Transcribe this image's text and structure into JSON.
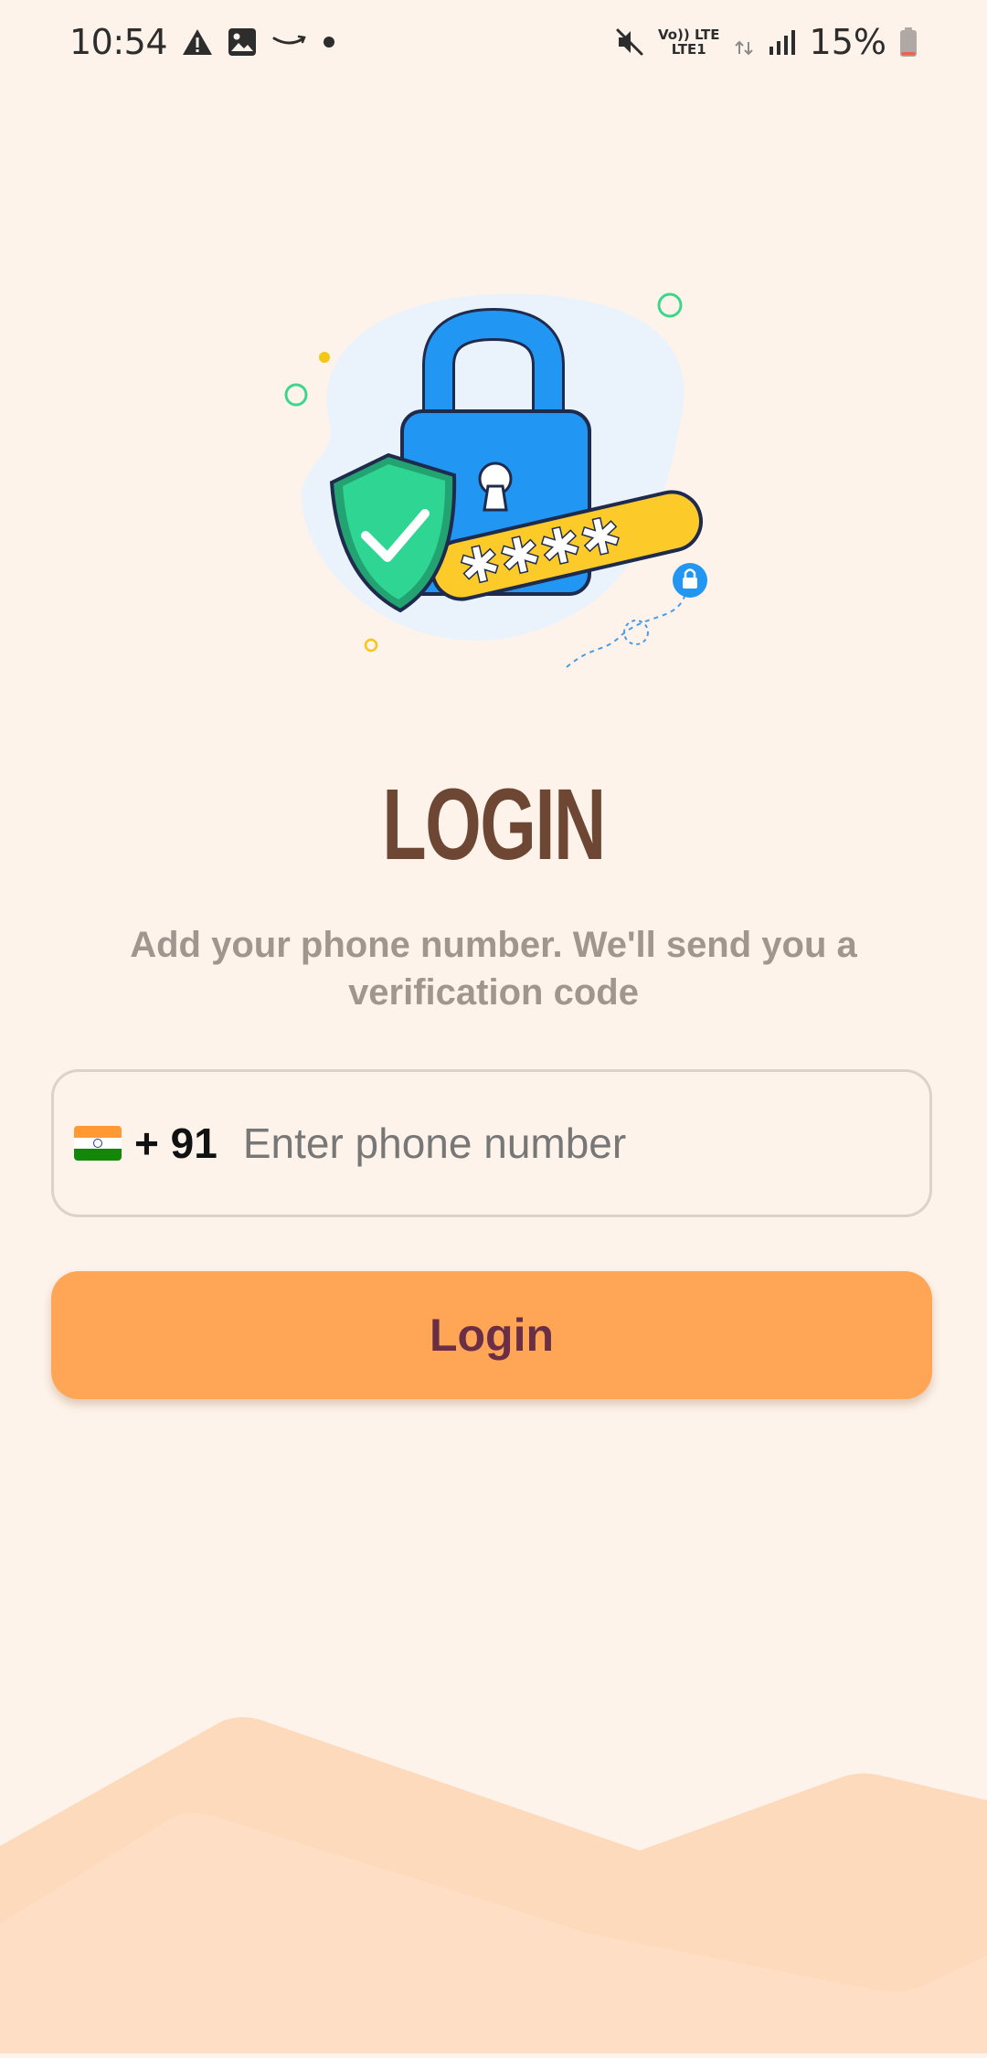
{
  "status_bar": {
    "time": "10:54",
    "battery_percent": "15%",
    "network_label_top": "Vo)) LTE",
    "network_label_bottom": "LTE1",
    "icons_left": [
      "warning-icon",
      "image-icon",
      "amazon-icon",
      "dot-icon"
    ],
    "icons_right": [
      "mute-icon",
      "volte-icon",
      "lte-data-icon",
      "signal-icon",
      "battery-icon"
    ]
  },
  "illustration": {
    "icon": "lock-shield-password-illustration"
  },
  "login": {
    "title": "LOGIN",
    "subtitle": "Add your phone number. We'll send you a verification code",
    "country_flag": "india-flag-icon",
    "country_code": "+ 91",
    "phone_placeholder": "Enter phone number",
    "phone_value": "",
    "button_label": "Login"
  },
  "colors": {
    "background": "#FEF3EA",
    "title": "#6E4634",
    "subtitle": "#A09690",
    "button_bg": "#FEA656",
    "button_text": "#6B2E47",
    "wave_back": "#FDD9BA",
    "wave_front": "#FEDDC0"
  }
}
